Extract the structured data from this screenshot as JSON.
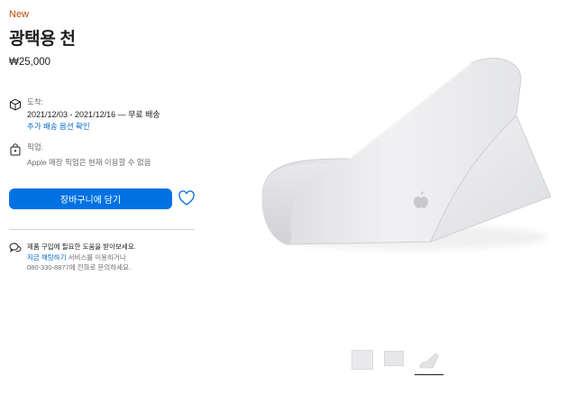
{
  "product": {
    "badge": "New",
    "title": "광택용 천",
    "price": "₩25,000"
  },
  "delivery": {
    "label": "도착:",
    "dates": "2021/12/03 - 2021/12/16 — 무료 배송",
    "more_link": "추가 배송 옵션 확인"
  },
  "pickup": {
    "label": "픽업:",
    "status": "Apple 매장 픽업은 현재 이용할 수 없음"
  },
  "actions": {
    "add_to_bag": "장바구니에 담기"
  },
  "help": {
    "title": "제품 구입에 필요한 도움을 받아보세요.",
    "link": "지금 채팅하기",
    "line2_rest": " 서비스를 이용하거나",
    "line3": "080-330-8877에 전화로 문의하세요."
  },
  "colors": {
    "accent": "#0071e3",
    "link": "#0066cc",
    "badge": "#bf4800"
  },
  "icons": [
    "box-icon",
    "bag-icon",
    "heart-icon",
    "chat-icon"
  ]
}
